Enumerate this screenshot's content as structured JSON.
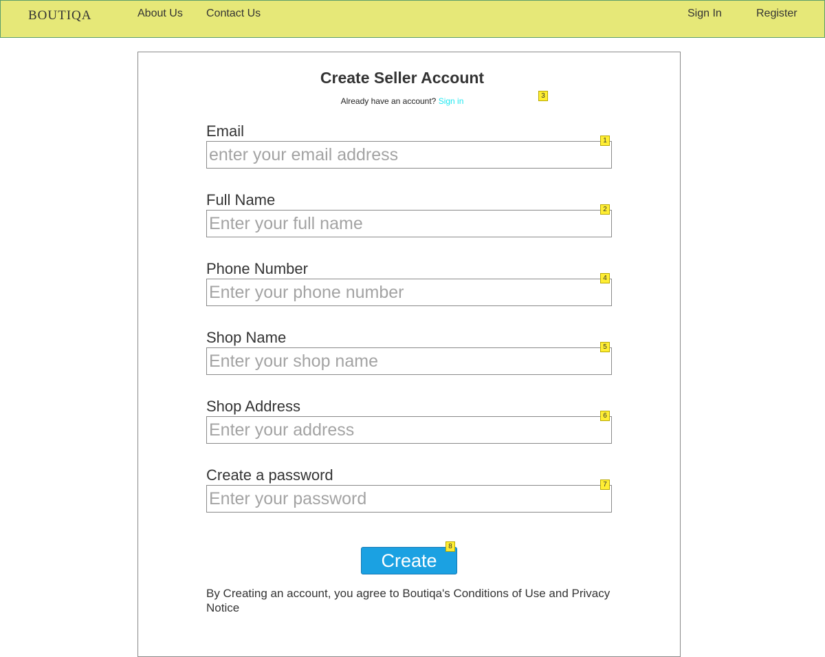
{
  "header": {
    "logo": "BOUTIQA",
    "nav_left": [
      "About Us",
      "Contact Us"
    ],
    "sign_in": "Sign In",
    "register": "Register",
    "background": "#e6e878"
  },
  "form": {
    "title": "Create Seller Account",
    "already_text": "Already have an account?",
    "sign_in_link": "Sign in",
    "link_color": "#1ee8f0",
    "fields": [
      {
        "label": "Email",
        "placeholder": "enter your email address",
        "value": "",
        "marker": "1"
      },
      {
        "label": "Full Name",
        "placeholder": "Enter your full name",
        "value": "",
        "marker": "2"
      },
      {
        "label": "Phone Number",
        "placeholder": "Enter your phone number",
        "value": "",
        "marker": "4"
      },
      {
        "label": "Shop Name",
        "placeholder": "Enter your shop name",
        "value": "",
        "marker": "5"
      },
      {
        "label": "Shop Address",
        "placeholder": "Enter your address",
        "value": "",
        "marker": "6"
      },
      {
        "label": "Create a password",
        "placeholder": "Enter your password",
        "value": "",
        "marker": "7"
      }
    ],
    "sign_in_marker": "3",
    "create_button": "Create",
    "create_marker": "8",
    "button_color": "#1ba1e2",
    "terms": "By Creating an account, you agree to Boutiqa's Conditions of Use and Privacy Notice"
  }
}
